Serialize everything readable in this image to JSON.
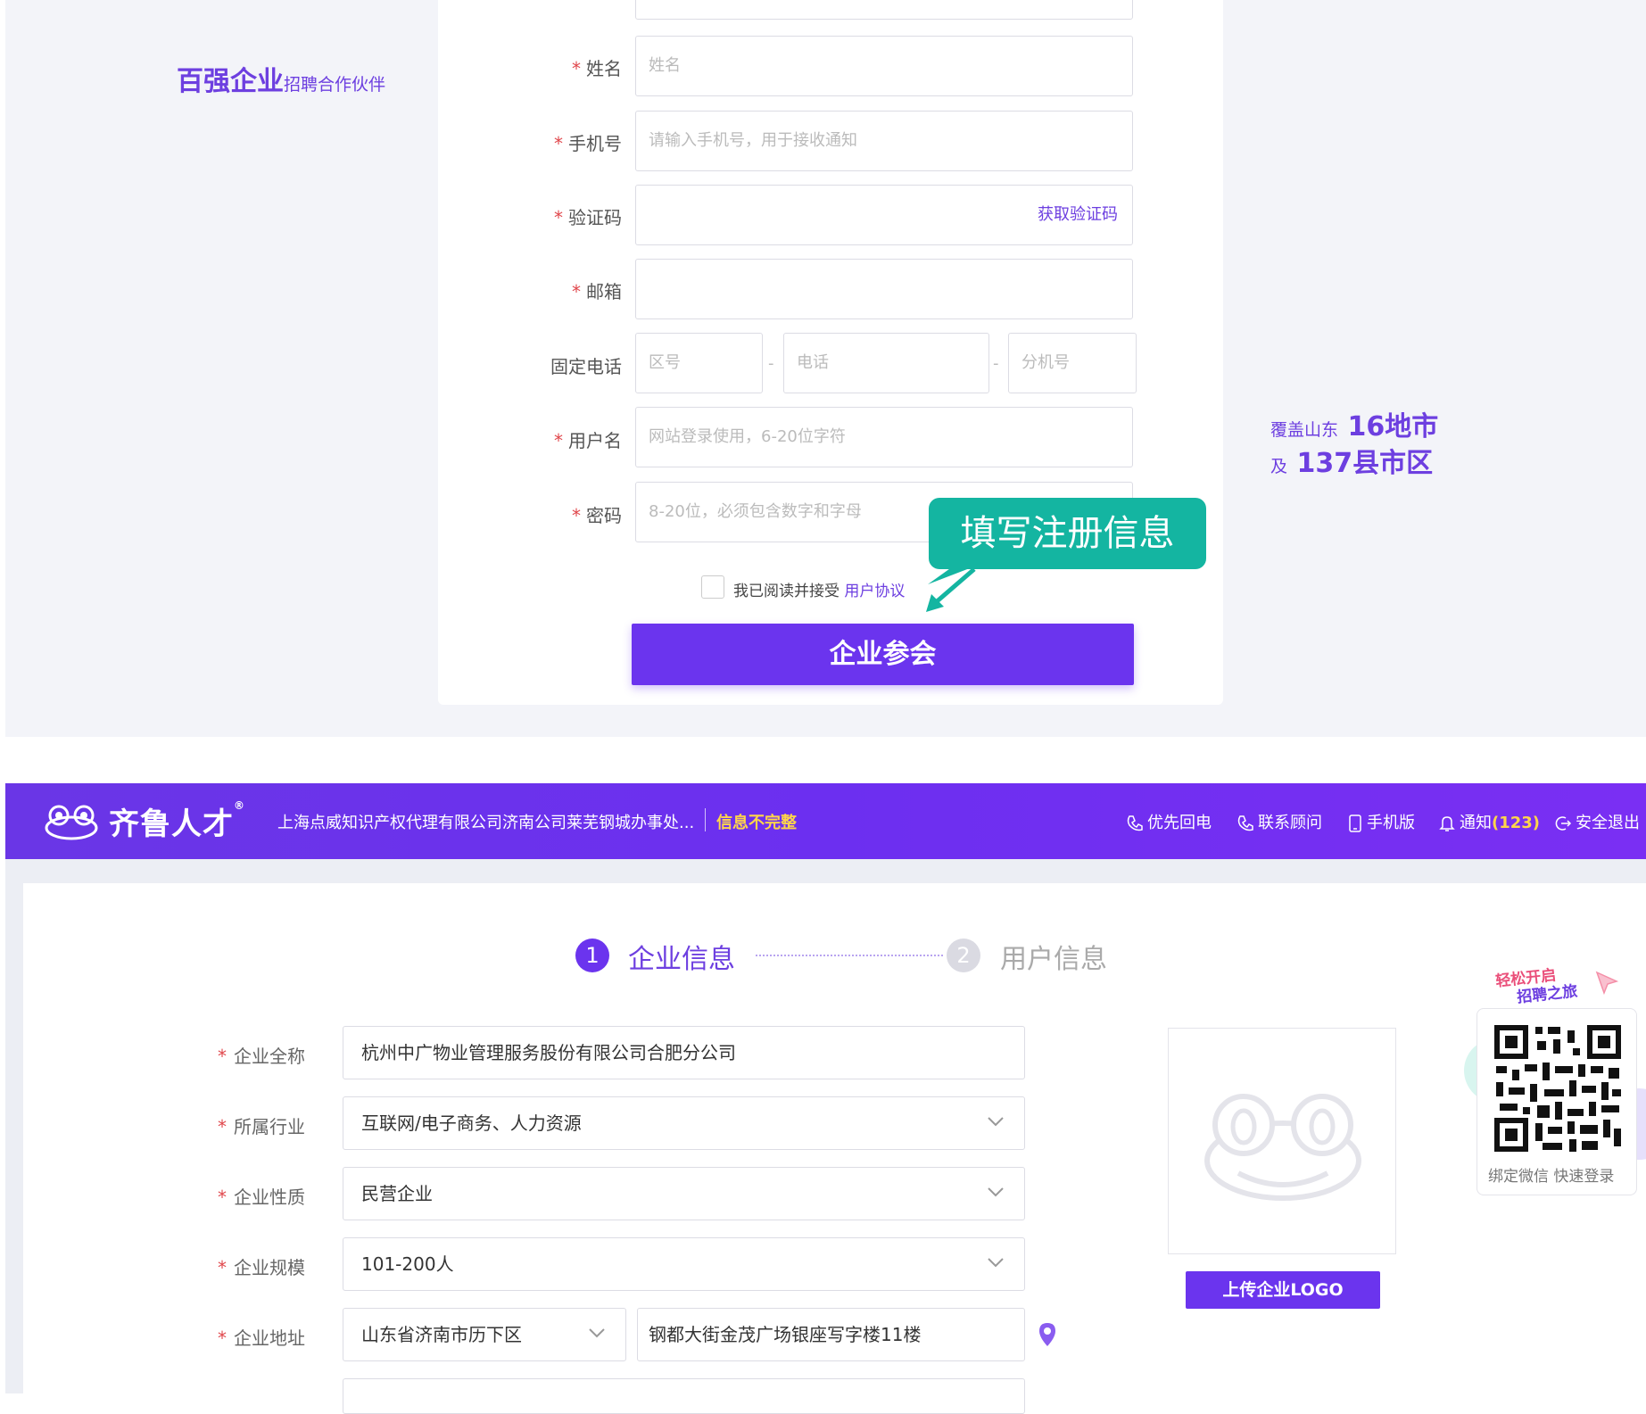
{
  "register": {
    "promo_left": {
      "strong": "百强企业",
      "small": "招聘合作伙伴"
    },
    "promo_right": {
      "line1_small": "覆盖山东",
      "line1_big": "16地市",
      "line2_small": "及",
      "line2_big": "137县市区"
    },
    "fields": [
      {
        "label": "姓名",
        "required": true,
        "placeholder": "姓名"
      },
      {
        "label": "手机号",
        "required": true,
        "placeholder": "请输入手机号，用于接收通知"
      },
      {
        "label": "验证码",
        "required": true,
        "placeholder": "",
        "action": "获取验证码"
      },
      {
        "label": "邮箱",
        "required": true,
        "placeholder": ""
      },
      {
        "label": "固定电话",
        "required": false,
        "parts": [
          "区号",
          "电话",
          "分机号"
        ],
        "separator": "-"
      },
      {
        "label": "用户名",
        "required": true,
        "placeholder": "网站登录使用，6-20位字符"
      },
      {
        "label": "密码",
        "required": true,
        "placeholder": "8-20位，必须包含数字和字母"
      }
    ],
    "required_mark": "*",
    "agree_text": "我已阅读并接受",
    "agree_link": "用户协议",
    "submit_label": "企业参会",
    "callout": "填写注册信息"
  },
  "nav": {
    "brand": "齐鲁人才",
    "brand_reg": "®",
    "company": "上海点威知识产权代理有限公司济南公司莱芜钢城办事处...",
    "status": "信息不完整",
    "items": [
      {
        "label": "优先回电",
        "icon": "phone-icon"
      },
      {
        "label": "联系顾问",
        "icon": "phone-icon"
      },
      {
        "label": "手机版",
        "icon": "mobile-icon"
      },
      {
        "label": "通知",
        "icon": "bell-icon",
        "count": "(123)"
      },
      {
        "label": "安全退出",
        "icon": "logout-icon"
      }
    ]
  },
  "steps": [
    {
      "num": "1",
      "label": "企业信息",
      "active": true
    },
    {
      "num": "2",
      "label": "用户信息",
      "active": false
    }
  ],
  "company_form": [
    {
      "label": "企业全称",
      "value": "杭州中广物业管理服务股份有限公司合肥分公司",
      "type": "text"
    },
    {
      "label": "所属行业",
      "value": "互联网/电子商务、人力资源",
      "type": "select"
    },
    {
      "label": "企业性质",
      "value": "民营企业",
      "type": "select"
    },
    {
      "label": "企业规模",
      "value": "101-200人",
      "type": "select"
    },
    {
      "label": "企业地址",
      "region": "山东省济南市历下区",
      "address": "钢都大街金茂广场银座写字楼11楼",
      "type": "address"
    }
  ],
  "upload_logo_label": "上传企业LOGO",
  "qr": {
    "slogan1": "轻松开启",
    "slogan2": "招聘之旅",
    "caption": "绑定微信 快速登录"
  },
  "colors": {
    "brand": "#6b34ee",
    "accent_teal": "#14b5a1",
    "warning": "#ffd54a",
    "required": "#e0474c"
  }
}
